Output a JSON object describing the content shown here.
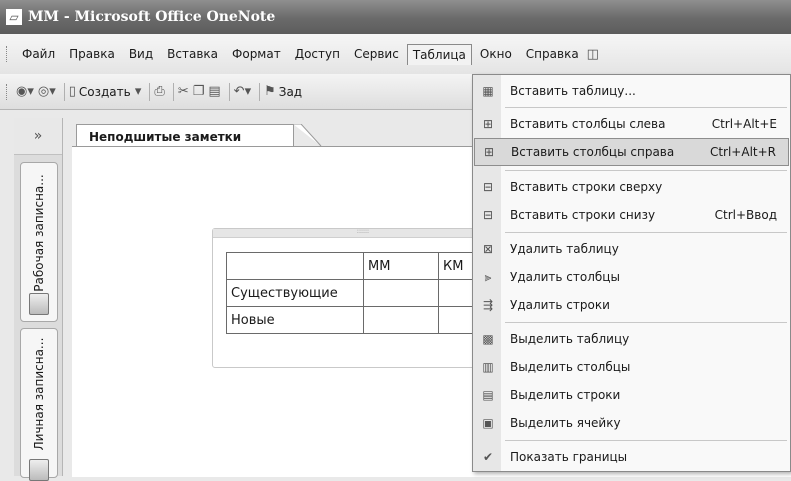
{
  "window": {
    "title": "ММ - Microsoft Office OneNote"
  },
  "menubar": {
    "items": [
      "Файл",
      "Правка",
      "Вид",
      "Вставка",
      "Формат",
      "Доступ",
      "Сервис",
      "Таблица",
      "Окно",
      "Справка"
    ],
    "active": "Таблица"
  },
  "toolbar": {
    "create_label": "Создать",
    "tasks_label": "Зад"
  },
  "sidebar": {
    "collapse": "»",
    "notebooks": [
      "Рабочая записна...",
      "Личная записна..."
    ]
  },
  "section_tab": "Неподшитые заметки",
  "note_table": {
    "headers": [
      "",
      "ММ",
      "КМ"
    ],
    "rows": [
      [
        "Существующие",
        "",
        ""
      ],
      [
        "Новые",
        "",
        ""
      ]
    ]
  },
  "table_menu": {
    "items": [
      {
        "label": "Вставить таблицу...",
        "shortcut": "",
        "icon": "table-icon"
      },
      {
        "label": "Вставить столбцы слева",
        "shortcut": "Ctrl+Alt+E",
        "icon": "insert-columns-left-icon"
      },
      {
        "label": "Вставить столбцы справа",
        "shortcut": "Ctrl+Alt+R",
        "icon": "insert-columns-right-icon"
      },
      {
        "label": "Вставить строки сверху",
        "shortcut": "",
        "icon": "insert-rows-above-icon"
      },
      {
        "label": "Вставить строки снизу",
        "shortcut": "Ctrl+Ввод",
        "icon": "insert-rows-below-icon"
      },
      {
        "label": "Удалить таблицу",
        "shortcut": "",
        "icon": "delete-table-icon"
      },
      {
        "label": "Удалить столбцы",
        "shortcut": "",
        "icon": "delete-columns-icon"
      },
      {
        "label": "Удалить строки",
        "shortcut": "",
        "icon": "delete-rows-icon"
      },
      {
        "label": "Выделить таблицу",
        "shortcut": "",
        "icon": "select-table-icon"
      },
      {
        "label": "Выделить столбцы",
        "shortcut": "",
        "icon": "select-columns-icon"
      },
      {
        "label": "Выделить строки",
        "shortcut": "",
        "icon": "select-rows-icon"
      },
      {
        "label": "Выделить ячейку",
        "shortcut": "",
        "icon": "select-cell-icon"
      },
      {
        "label": "Показать границы",
        "shortcut": "",
        "icon": "checkmark-icon"
      }
    ],
    "highlighted": "Вставить столбцы справа"
  }
}
